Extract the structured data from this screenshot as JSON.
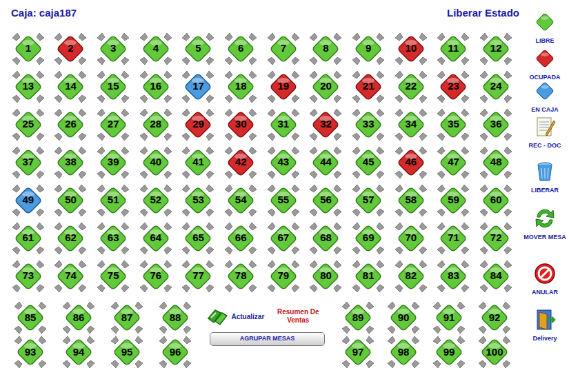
{
  "header": {
    "caja": "Caja: caja187",
    "liberar_estado": "Liberar Estado"
  },
  "tables": [
    {
      "label": "1",
      "status": "libre",
      "color": "#62c93a"
    },
    {
      "label": "2",
      "status": "ocupada",
      "color": "#d42a2a"
    },
    {
      "label": "3",
      "status": "libre",
      "color": "#62c93a"
    },
    {
      "label": "4",
      "status": "libre",
      "color": "#62c93a"
    },
    {
      "label": "5",
      "status": "libre",
      "color": "#62c93a"
    },
    {
      "label": "6",
      "status": "libre",
      "color": "#62c93a"
    },
    {
      "label": "7",
      "status": "libre",
      "color": "#62c93a"
    },
    {
      "label": "8",
      "status": "libre",
      "color": "#62c93a"
    },
    {
      "label": "9",
      "status": "libre",
      "color": "#62c93a"
    },
    {
      "label": "10",
      "status": "ocupada",
      "color": "#d42a2a"
    },
    {
      "label": "11",
      "status": "libre",
      "color": "#62c93a"
    },
    {
      "label": "12",
      "status": "libre",
      "color": "#62c93a"
    },
    {
      "label": "13",
      "status": "libre",
      "color": "#62c93a"
    },
    {
      "label": "14",
      "status": "libre",
      "color": "#62c93a"
    },
    {
      "label": "15",
      "status": "libre",
      "color": "#62c93a"
    },
    {
      "label": "16",
      "status": "libre",
      "color": "#62c93a"
    },
    {
      "label": "17",
      "status": "en_caja",
      "color": "#4a9be0"
    },
    {
      "label": "18",
      "status": "libre",
      "color": "#62c93a"
    },
    {
      "label": "19",
      "status": "ocupada",
      "color": "#d42a2a"
    },
    {
      "label": "20",
      "status": "libre",
      "color": "#62c93a"
    },
    {
      "label": "21",
      "status": "ocupada",
      "color": "#d42a2a"
    },
    {
      "label": "22",
      "status": "libre",
      "color": "#62c93a"
    },
    {
      "label": "23",
      "status": "ocupada",
      "color": "#d42a2a"
    },
    {
      "label": "24",
      "status": "libre",
      "color": "#62c93a"
    },
    {
      "label": "25",
      "status": "libre",
      "color": "#62c93a"
    },
    {
      "label": "26",
      "status": "libre",
      "color": "#62c93a"
    },
    {
      "label": "27",
      "status": "libre",
      "color": "#62c93a"
    },
    {
      "label": "28",
      "status": "libre",
      "color": "#62c93a"
    },
    {
      "label": "29",
      "status": "ocupada",
      "color": "#d42a2a"
    },
    {
      "label": "30",
      "status": "ocupada",
      "color": "#d42a2a"
    },
    {
      "label": "31",
      "status": "libre",
      "color": "#62c93a"
    },
    {
      "label": "32",
      "status": "ocupada",
      "color": "#d42a2a"
    },
    {
      "label": "33",
      "status": "libre",
      "color": "#62c93a"
    },
    {
      "label": "34",
      "status": "libre",
      "color": "#62c93a"
    },
    {
      "label": "35",
      "status": "libre",
      "color": "#62c93a"
    },
    {
      "label": "36",
      "status": "libre",
      "color": "#62c93a"
    },
    {
      "label": "37",
      "status": "libre",
      "color": "#62c93a"
    },
    {
      "label": "38",
      "status": "libre",
      "color": "#62c93a"
    },
    {
      "label": "39",
      "status": "libre",
      "color": "#62c93a"
    },
    {
      "label": "40",
      "status": "libre",
      "color": "#62c93a"
    },
    {
      "label": "41",
      "status": "libre",
      "color": "#62c93a"
    },
    {
      "label": "42",
      "status": "ocupada",
      "color": "#d42a2a"
    },
    {
      "label": "43",
      "status": "libre",
      "color": "#62c93a"
    },
    {
      "label": "44",
      "status": "libre",
      "color": "#62c93a"
    },
    {
      "label": "45",
      "status": "libre",
      "color": "#62c93a"
    },
    {
      "label": "46",
      "status": "ocupada",
      "color": "#d42a2a"
    },
    {
      "label": "47",
      "status": "libre",
      "color": "#62c93a"
    },
    {
      "label": "48",
      "status": "libre",
      "color": "#62c93a"
    },
    {
      "label": "49",
      "status": "en_caja",
      "color": "#4a9be0"
    },
    {
      "label": "50",
      "status": "libre",
      "color": "#62c93a"
    },
    {
      "label": "51",
      "status": "libre",
      "color": "#62c93a"
    },
    {
      "label": "52",
      "status": "libre",
      "color": "#62c93a"
    },
    {
      "label": "53",
      "status": "libre",
      "color": "#62c93a"
    },
    {
      "label": "54",
      "status": "libre",
      "color": "#62c93a"
    },
    {
      "label": "55",
      "status": "libre",
      "color": "#62c93a"
    },
    {
      "label": "56",
      "status": "libre",
      "color": "#62c93a"
    },
    {
      "label": "57",
      "status": "libre",
      "color": "#62c93a"
    },
    {
      "label": "58",
      "status": "libre",
      "color": "#62c93a"
    },
    {
      "label": "59",
      "status": "libre",
      "color": "#62c93a"
    },
    {
      "label": "60",
      "status": "libre",
      "color": "#62c93a"
    },
    {
      "label": "61",
      "status": "libre",
      "color": "#62c93a"
    },
    {
      "label": "62",
      "status": "libre",
      "color": "#62c93a"
    },
    {
      "label": "63",
      "status": "libre",
      "color": "#62c93a"
    },
    {
      "label": "64",
      "status": "libre",
      "color": "#62c93a"
    },
    {
      "label": "65",
      "status": "libre",
      "color": "#62c93a"
    },
    {
      "label": "66",
      "status": "libre",
      "color": "#62c93a"
    },
    {
      "label": "67",
      "status": "libre",
      "color": "#62c93a"
    },
    {
      "label": "68",
      "status": "libre",
      "color": "#62c93a"
    },
    {
      "label": "69",
      "status": "libre",
      "color": "#62c93a"
    },
    {
      "label": "70",
      "status": "libre",
      "color": "#62c93a"
    },
    {
      "label": "71",
      "status": "libre",
      "color": "#62c93a"
    },
    {
      "label": "72",
      "status": "libre",
      "color": "#62c93a"
    },
    {
      "label": "73",
      "status": "libre",
      "color": "#62c93a"
    },
    {
      "label": "74",
      "status": "libre",
      "color": "#62c93a"
    },
    {
      "label": "75",
      "status": "libre",
      "color": "#62c93a"
    },
    {
      "label": "76",
      "status": "libre",
      "color": "#62c93a"
    },
    {
      "label": "77",
      "status": "libre",
      "color": "#62c93a"
    },
    {
      "label": "78",
      "status": "libre",
      "color": "#62c93a"
    },
    {
      "label": "79",
      "status": "libre",
      "color": "#62c93a"
    },
    {
      "label": "80",
      "status": "libre",
      "color": "#62c93a"
    },
    {
      "label": "81",
      "status": "libre",
      "color": "#62c93a"
    },
    {
      "label": "82",
      "status": "libre",
      "color": "#62c93a"
    },
    {
      "label": "83",
      "status": "libre",
      "color": "#62c93a"
    },
    {
      "label": "84",
      "status": "libre",
      "color": "#62c93a"
    },
    {
      "label": "85",
      "status": "libre",
      "color": "#62c93a"
    },
    {
      "label": "86",
      "status": "libre",
      "color": "#62c93a"
    },
    {
      "label": "87",
      "status": "libre",
      "color": "#62c93a"
    },
    {
      "label": "88",
      "status": "libre",
      "color": "#62c93a"
    },
    {
      "label": "89",
      "status": "libre",
      "color": "#62c93a"
    },
    {
      "label": "90",
      "status": "libre",
      "color": "#62c93a"
    },
    {
      "label": "91",
      "status": "libre",
      "color": "#62c93a"
    },
    {
      "label": "92",
      "status": "libre",
      "color": "#62c93a"
    },
    {
      "label": "93",
      "status": "libre",
      "color": "#62c93a"
    },
    {
      "label": "94",
      "status": "libre",
      "color": "#62c93a"
    },
    {
      "label": "95",
      "status": "libre",
      "color": "#62c93a"
    },
    {
      "label": "96",
      "status": "libre",
      "color": "#62c93a"
    },
    {
      "label": "97",
      "status": "libre",
      "color": "#62c93a"
    },
    {
      "label": "98",
      "status": "libre",
      "color": "#62c93a"
    },
    {
      "label": "99",
      "status": "libre",
      "color": "#62c93a"
    },
    {
      "label": "100",
      "status": "libre",
      "color": "#62c93a"
    }
  ],
  "toolbar": {
    "actualizar": "Actualizar",
    "resumen": "Resumen De Ventas",
    "agrupar": "AGRUPAR MESAS"
  },
  "sidebar": [
    {
      "label": "LIBRE",
      "kind": "libre"
    },
    {
      "label": "OCUPADA",
      "kind": "ocupada"
    },
    {
      "label": "EN CAJA",
      "kind": "encaja"
    },
    {
      "label": "REC - DOC",
      "kind": "recdoc"
    },
    {
      "label": "LIBERAR",
      "kind": "liberar"
    },
    {
      "label": "MOVER MESA",
      "kind": "mover"
    },
    {
      "label": "ANULAR",
      "kind": "anular"
    },
    {
      "label": "Delivery",
      "kind": "delivery"
    }
  ]
}
